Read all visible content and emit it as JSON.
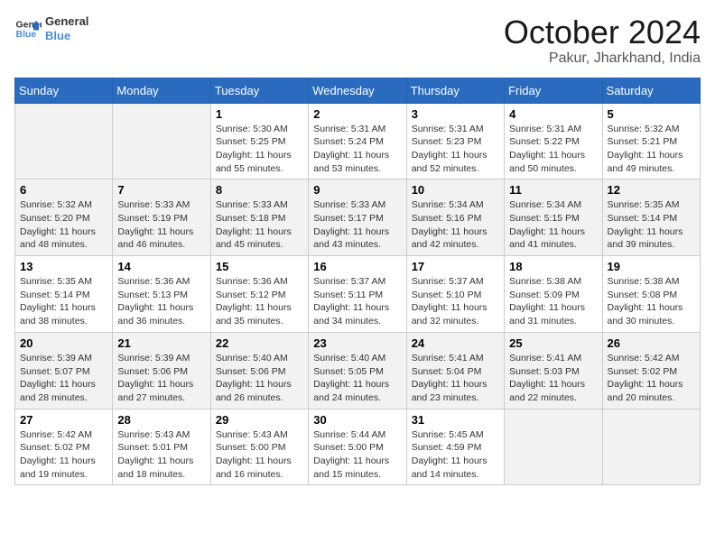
{
  "logo": {
    "line1": "General",
    "line2": "Blue"
  },
  "title": "October 2024",
  "location": "Pakur, Jharkhand, India",
  "days_of_week": [
    "Sunday",
    "Monday",
    "Tuesday",
    "Wednesday",
    "Thursday",
    "Friday",
    "Saturday"
  ],
  "weeks": [
    [
      {
        "day": "",
        "detail": ""
      },
      {
        "day": "",
        "detail": ""
      },
      {
        "day": "1",
        "detail": "Sunrise: 5:30 AM\nSunset: 5:25 PM\nDaylight: 11 hours and 55 minutes."
      },
      {
        "day": "2",
        "detail": "Sunrise: 5:31 AM\nSunset: 5:24 PM\nDaylight: 11 hours and 53 minutes."
      },
      {
        "day": "3",
        "detail": "Sunrise: 5:31 AM\nSunset: 5:23 PM\nDaylight: 11 hours and 52 minutes."
      },
      {
        "day": "4",
        "detail": "Sunrise: 5:31 AM\nSunset: 5:22 PM\nDaylight: 11 hours and 50 minutes."
      },
      {
        "day": "5",
        "detail": "Sunrise: 5:32 AM\nSunset: 5:21 PM\nDaylight: 11 hours and 49 minutes."
      }
    ],
    [
      {
        "day": "6",
        "detail": "Sunrise: 5:32 AM\nSunset: 5:20 PM\nDaylight: 11 hours and 48 minutes."
      },
      {
        "day": "7",
        "detail": "Sunrise: 5:33 AM\nSunset: 5:19 PM\nDaylight: 11 hours and 46 minutes."
      },
      {
        "day": "8",
        "detail": "Sunrise: 5:33 AM\nSunset: 5:18 PM\nDaylight: 11 hours and 45 minutes."
      },
      {
        "day": "9",
        "detail": "Sunrise: 5:33 AM\nSunset: 5:17 PM\nDaylight: 11 hours and 43 minutes."
      },
      {
        "day": "10",
        "detail": "Sunrise: 5:34 AM\nSunset: 5:16 PM\nDaylight: 11 hours and 42 minutes."
      },
      {
        "day": "11",
        "detail": "Sunrise: 5:34 AM\nSunset: 5:15 PM\nDaylight: 11 hours and 41 minutes."
      },
      {
        "day": "12",
        "detail": "Sunrise: 5:35 AM\nSunset: 5:14 PM\nDaylight: 11 hours and 39 minutes."
      }
    ],
    [
      {
        "day": "13",
        "detail": "Sunrise: 5:35 AM\nSunset: 5:14 PM\nDaylight: 11 hours and 38 minutes."
      },
      {
        "day": "14",
        "detail": "Sunrise: 5:36 AM\nSunset: 5:13 PM\nDaylight: 11 hours and 36 minutes."
      },
      {
        "day": "15",
        "detail": "Sunrise: 5:36 AM\nSunset: 5:12 PM\nDaylight: 11 hours and 35 minutes."
      },
      {
        "day": "16",
        "detail": "Sunrise: 5:37 AM\nSunset: 5:11 PM\nDaylight: 11 hours and 34 minutes."
      },
      {
        "day": "17",
        "detail": "Sunrise: 5:37 AM\nSunset: 5:10 PM\nDaylight: 11 hours and 32 minutes."
      },
      {
        "day": "18",
        "detail": "Sunrise: 5:38 AM\nSunset: 5:09 PM\nDaylight: 11 hours and 31 minutes."
      },
      {
        "day": "19",
        "detail": "Sunrise: 5:38 AM\nSunset: 5:08 PM\nDaylight: 11 hours and 30 minutes."
      }
    ],
    [
      {
        "day": "20",
        "detail": "Sunrise: 5:39 AM\nSunset: 5:07 PM\nDaylight: 11 hours and 28 minutes."
      },
      {
        "day": "21",
        "detail": "Sunrise: 5:39 AM\nSunset: 5:06 PM\nDaylight: 11 hours and 27 minutes."
      },
      {
        "day": "22",
        "detail": "Sunrise: 5:40 AM\nSunset: 5:06 PM\nDaylight: 11 hours and 26 minutes."
      },
      {
        "day": "23",
        "detail": "Sunrise: 5:40 AM\nSunset: 5:05 PM\nDaylight: 11 hours and 24 minutes."
      },
      {
        "day": "24",
        "detail": "Sunrise: 5:41 AM\nSunset: 5:04 PM\nDaylight: 11 hours and 23 minutes."
      },
      {
        "day": "25",
        "detail": "Sunrise: 5:41 AM\nSunset: 5:03 PM\nDaylight: 11 hours and 22 minutes."
      },
      {
        "day": "26",
        "detail": "Sunrise: 5:42 AM\nSunset: 5:02 PM\nDaylight: 11 hours and 20 minutes."
      }
    ],
    [
      {
        "day": "27",
        "detail": "Sunrise: 5:42 AM\nSunset: 5:02 PM\nDaylight: 11 hours and 19 minutes."
      },
      {
        "day": "28",
        "detail": "Sunrise: 5:43 AM\nSunset: 5:01 PM\nDaylight: 11 hours and 18 minutes."
      },
      {
        "day": "29",
        "detail": "Sunrise: 5:43 AM\nSunset: 5:00 PM\nDaylight: 11 hours and 16 minutes."
      },
      {
        "day": "30",
        "detail": "Sunrise: 5:44 AM\nSunset: 5:00 PM\nDaylight: 11 hours and 15 minutes."
      },
      {
        "day": "31",
        "detail": "Sunrise: 5:45 AM\nSunset: 4:59 PM\nDaylight: 11 hours and 14 minutes."
      },
      {
        "day": "",
        "detail": ""
      },
      {
        "day": "",
        "detail": ""
      }
    ]
  ]
}
